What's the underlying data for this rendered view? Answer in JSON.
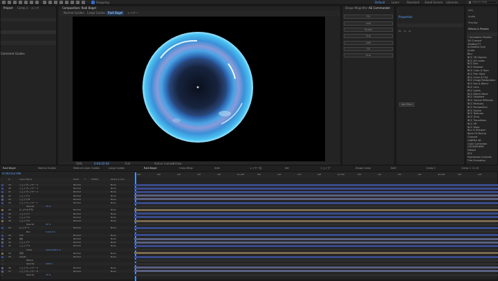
{
  "tools": {
    "snapping_label": "Snapping"
  },
  "workspaces": [
    {
      "label": "Default",
      "active": true
    },
    {
      "label": "Learn"
    },
    {
      "label": "Standard"
    },
    {
      "label": "Small Screen"
    },
    {
      "label": "Libraries"
    }
  ],
  "search": {
    "placeholder": "Search Help"
  },
  "project_panel": {
    "tab": "Project",
    "comment_label": "Comment Guides",
    "comp_title": "Comp 1 · コンポ"
  },
  "comp_panel": {
    "tab": "Composition: Radi Bagel",
    "subtabs": [
      "Normal Guides",
      "Large Guides",
      "Radi Bagel",
      "レイヤー"
    ],
    "zoom": "50%",
    "resolution": "Full",
    "time": "0:00:02:06",
    "camera": "Active Camera",
    "view": "1 View"
  },
  "right_panel": {
    "tab": "Shape Magnifier",
    "tab2": "AE Commander",
    "buttons": [
      "Fill",
      "Add",
      "Stroke",
      "Sub",
      "Add",
      "Fill",
      "Sub"
    ]
  },
  "properties_panel": {
    "title": "Properties",
    "labels": [
      "fill",
      "st",
      "bl"
    ],
    "button": "Add Effect"
  },
  "effects_panel": {
    "tabs": [
      "Info",
      "Audio",
      "Preview",
      "Effects & Presets"
    ],
    "items": [
      "* Animation Presets",
      "3D Channel",
      "3DxBay???",
      "Animated Gym",
      "Audio",
      "Blur",
      "BCC 3D Objects",
      "BCC Art Looks",
      "BCC Blur",
      "BCC Browser",
      "BCC Color & Tone",
      "BCC Film Style",
      "BCC Grain & Tint",
      "BCC Image Restoration",
      "BCC Key & Blend",
      "BCC Lens",
      "BCC Lights",
      "BCC Match Move",
      "BCC Obsolete",
      "BCC Optical Diffusion",
      "BCC Particles",
      "BCC Perspective",
      "BCC Stylize",
      "BCC Textures",
      "BCC Time",
      "BCC Transitions",
      "BCC VR",
      "BCC Warp",
      "Blur & Sharpen",
      "Boris FX Mocha",
      "Channel",
      "CINEMA 4D",
      "Color Correction",
      "CROSSPHERE",
      "Distort",
      "EFX",
      "Expression Controls",
      "Film Emulation"
    ]
  },
  "timeline": {
    "time": "0:00:02:06",
    "tabs": [
      "Radi Bagel",
      "Normal Guides",
      "Medium Layer Guides",
      "Large Guides",
      "Radi Bagel",
      "Cross Wing",
      "Side",
      "レイヤー名",
      "Set",
      "シェイプ",
      "Shape Comp",
      "Set2",
      "Comp 2",
      "Comp 1 コンポ"
    ],
    "columns": [
      "#",
      "Layer Name",
      "Mode",
      "T",
      "TrkMat",
      "Parent & Link"
    ],
    "rulers": [
      "00f",
      "05f",
      "10f",
      "15f",
      "20f",
      "01:00f",
      "05f",
      "10f",
      "15f",
      "20f",
      "02:00f",
      "05f",
      "10f",
      "15f",
      "20f",
      "03:00f",
      "05f",
      "10f"
    ],
    "layers": [
      {
        "num": "19",
        "name": "シェイプレイヤー 4",
        "mode": "Normal",
        "parent": "None",
        "color": "#3a4a8a"
      },
      {
        "num": "20",
        "name": "シェイプレイヤー 3",
        "mode": "Normal",
        "parent": "None",
        "color": "#3a4a8a"
      },
      {
        "num": "21",
        "name": "シェイプレイヤー 2",
        "mode": "Normal",
        "parent": "None",
        "color": "#3a4a8a"
      },
      {
        "num": "22",
        "name": "シェイプ A",
        "mode": "Normal",
        "parent": "None",
        "color": "#5a6080"
      },
      {
        "num": "23",
        "name": "シェイプ B",
        "mode": "Normal",
        "parent": "None",
        "color": "#5a6080"
      },
      {
        "num": "24",
        "name": "シェイプレイヤー 1",
        "mode": "Normal",
        "parent": "None",
        "color": "#3a4a8a"
      },
      {
        "num": "",
        "name": "Opacity",
        "mode": "",
        "parent": "",
        "color": "#2e2e2e",
        "value": "70 %"
      },
      {
        "num": "25",
        "name": "[ヒコウキグモ]",
        "mode": "Normal",
        "parent": "None",
        "color": "#7a6a50"
      },
      {
        "num": "26",
        "name": "シェイプ C",
        "mode": "Normal",
        "parent": "None",
        "color": "#3a4a8a"
      },
      {
        "num": "27",
        "name": "シェイプ D",
        "mode": "Normal",
        "parent": "None",
        "color": "#3a4a8a"
      },
      {
        "num": "28",
        "name": "シェイプ E",
        "mode": "Normal",
        "parent": "None",
        "color": "#7a6a50"
      },
      {
        "num": "",
        "name": "Opacity",
        "mode": "",
        "parent": "",
        "color": "#2e2e2e",
        "value": "20 %"
      },
      {
        "num": "29",
        "name": "[レイヤー]",
        "mode": "Normal",
        "parent": "None",
        "color": "#3a4a8a"
      },
      {
        "num": "",
        "name": "Blur",
        "mode": "",
        "parent": "",
        "color": "#2e2e2e",
        "value": "0.0,0.0 %"
      },
      {
        "num": "30",
        "name": "Tint",
        "mode": "Normal",
        "parent": "None",
        "color": "#3a4a8a"
      },
      {
        "num": "31",
        "name": "[色]",
        "mode": "Normal",
        "parent": "None",
        "color": "#5a6080"
      },
      {
        "num": "32",
        "name": "シェイプ F",
        "mode": "Normal",
        "parent": "None",
        "color": "#5a6080"
      },
      {
        "num": "33",
        "name": "シェイプ G",
        "mode": "Normal",
        "parent": "None",
        "color": "#3a4a8a"
      },
      {
        "num": "",
        "name": "Scale",
        "mode": "",
        "parent": "",
        "color": "#2e2e2e",
        "value": "100.0,100.0 %"
      },
      {
        "num": "34",
        "name": "背景",
        "mode": "Normal",
        "parent": "None",
        "color": "#7a6a50"
      },
      {
        "num": "35",
        "name": "Adjust",
        "mode": "Normal",
        "parent": "None",
        "color": "#3a4a8a"
      },
      {
        "num": "",
        "name": "Effects",
        "mode": "",
        "parent": "",
        "color": "#2e2e2e"
      },
      {
        "num": "",
        "name": "Opacity",
        "mode": "",
        "parent": "",
        "color": "#2e2e2e",
        "value": "100 %"
      },
      {
        "num": "36",
        "name": "シェイプレイヤー 5",
        "mode": "Normal",
        "parent": "None",
        "color": "#5a6080"
      },
      {
        "num": "37",
        "name": "シェイプレイヤー 6",
        "mode": "Normal",
        "parent": "None",
        "color": "#5a6080"
      },
      {
        "num": "",
        "name": "Opacity",
        "mode": "",
        "parent": "",
        "color": "#2e2e2e",
        "value": "70 %"
      }
    ]
  }
}
